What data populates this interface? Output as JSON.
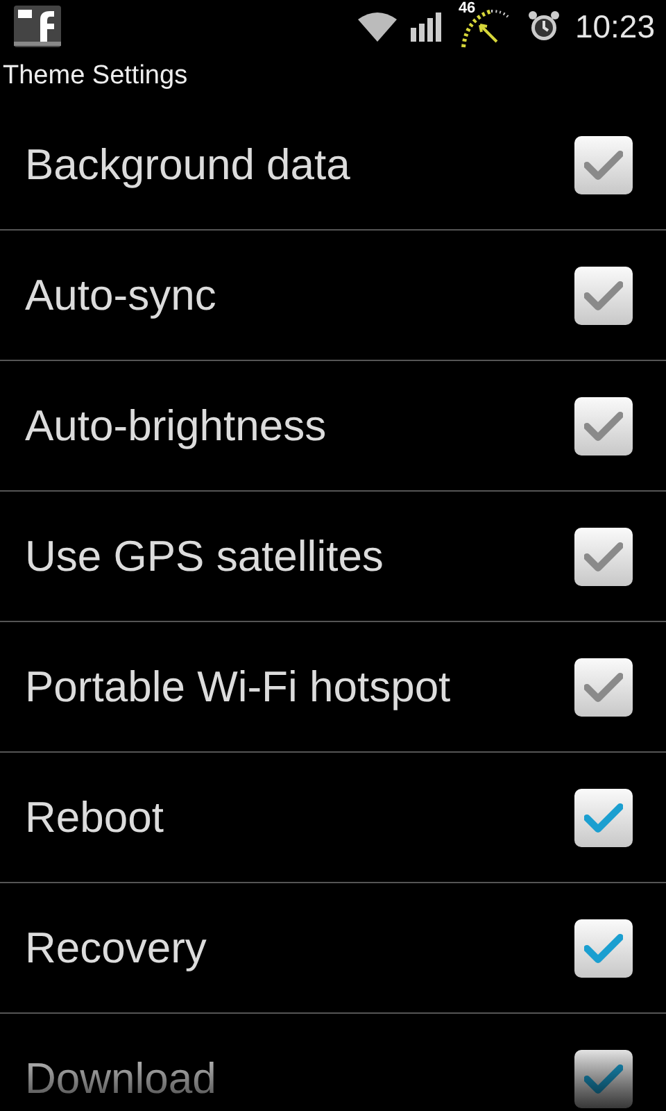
{
  "status_bar": {
    "speed": "46",
    "time": "10:23"
  },
  "title": "Theme Settings",
  "settings": [
    {
      "label": "Background data",
      "checked": true,
      "disabled": true
    },
    {
      "label": "Auto-sync",
      "checked": true,
      "disabled": true
    },
    {
      "label": "Auto-brightness",
      "checked": true,
      "disabled": true
    },
    {
      "label": "Use GPS satellites",
      "checked": true,
      "disabled": true
    },
    {
      "label": "Portable Wi-Fi hotspot",
      "checked": true,
      "disabled": true
    },
    {
      "label": "Reboot",
      "checked": true,
      "disabled": false
    },
    {
      "label": "Recovery",
      "checked": true,
      "disabled": false
    },
    {
      "label": "Download",
      "checked": true,
      "disabled": false
    }
  ]
}
